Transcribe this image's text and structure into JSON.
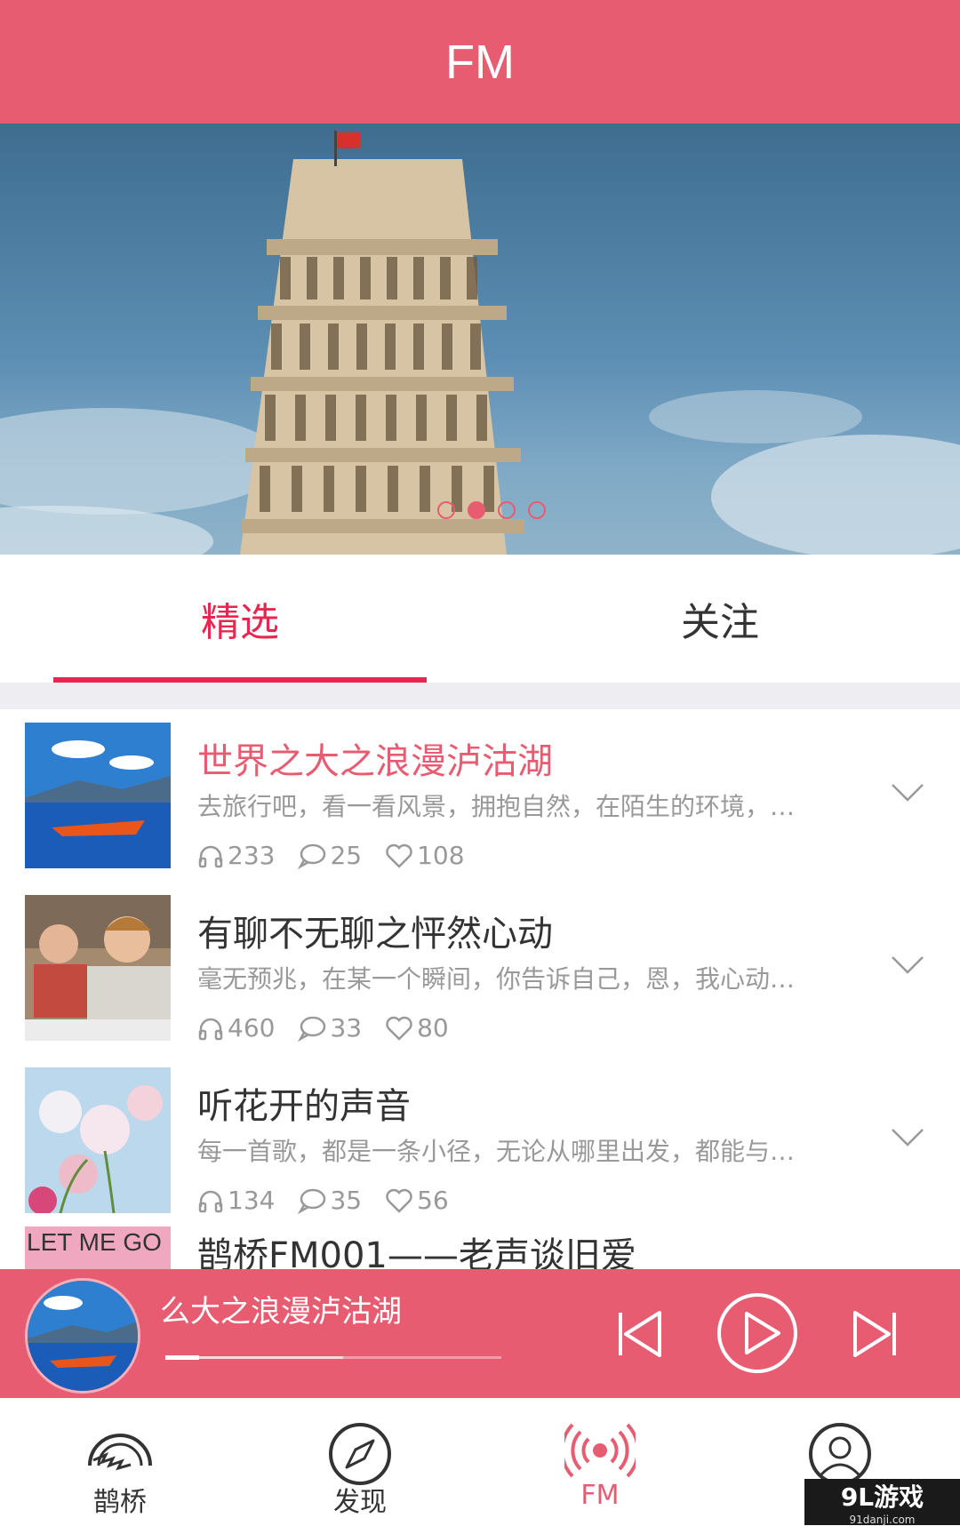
{
  "header": {
    "title": "FM"
  },
  "banner": {
    "dots": 4,
    "active_dot": 1
  },
  "tabs": [
    {
      "label": "精选",
      "active": true
    },
    {
      "label": "关注",
      "active": false
    }
  ],
  "list": [
    {
      "title": "世界之大之浪漫泸沽湖",
      "desc": "去旅行吧，看一看风景，拥抱自然，在陌生的环境，…",
      "plays": "233",
      "comments": "25",
      "likes": "108"
    },
    {
      "title": "有聊不无聊之怦然心动",
      "desc": "毫无预兆，在某一个瞬间，你告诉自己，恩，我心动…",
      "plays": "460",
      "comments": "33",
      "likes": "80"
    },
    {
      "title": "听花开的声音",
      "desc": "每一首歌，都是一条小径，无论从哪里出发，都能与…",
      "plays": "134",
      "comments": "35",
      "likes": "56"
    },
    {
      "title": "鹊桥FM001——老声谈旧爱",
      "thumb_text": "LET ME GO"
    }
  ],
  "player": {
    "now_playing": "么大之浪漫泸沽湖",
    "progress_percent": 10,
    "buffer_percent": 53
  },
  "nav": [
    {
      "label": "鹊桥",
      "icon": "bridge-icon"
    },
    {
      "label": "发现",
      "icon": "compass-icon"
    },
    {
      "label": "FM",
      "icon": "radio-icon",
      "active": true
    },
    {
      "label": "我",
      "icon": "user-icon"
    }
  ],
  "watermark": {
    "brand": "9L游戏",
    "site": "91danji.com"
  },
  "colors": {
    "accent": "#e85c72",
    "tab_active": "#e8264f"
  }
}
